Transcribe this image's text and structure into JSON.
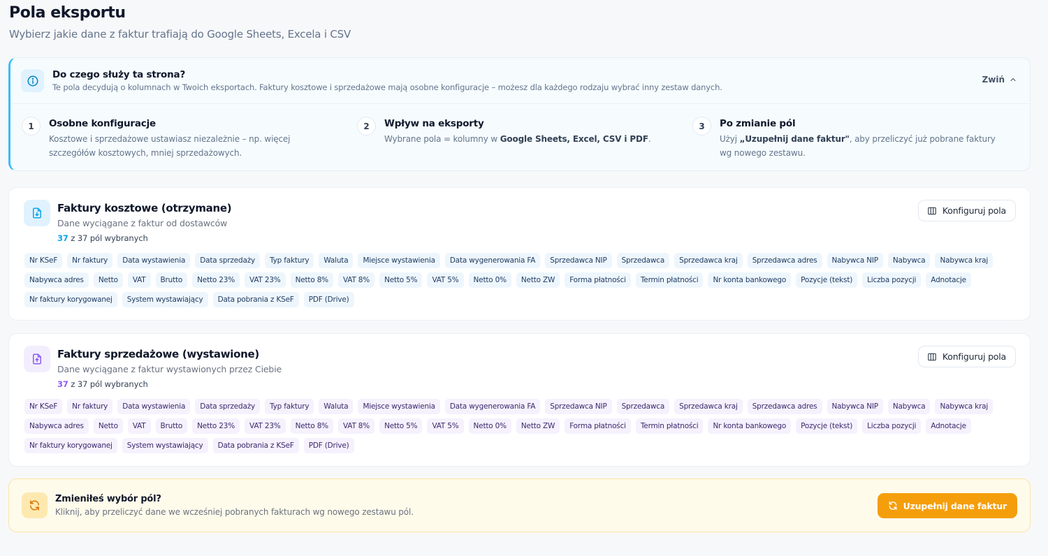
{
  "header": {
    "title": "Pola eksportu",
    "subtitle": "Wybierz jakie dane z faktur trafiają do Google Sheets, Excela i CSV"
  },
  "info": {
    "icon": "info-icon",
    "title": "Do czego służy ta strona?",
    "description": "Te pola decydują o kolumnach w Twoich eksportach. Faktury kosztowe i sprzedażowe mają osobne konfiguracje – możesz dla każdego rodzaju wybrać inny zestaw danych.",
    "collapse_label": "Zwiń",
    "steps": [
      {
        "num": "1",
        "title": "Osobne konfiguracje",
        "pre": "Kosztowe i sprzedażowe ustawiasz niezależnie – np. więcej szczegółów kosztowych, mniej sprzedażowych.",
        "bold": "",
        "post": ""
      },
      {
        "num": "2",
        "title": "Wpływ na eksporty",
        "pre": "Wybrane pola = kolumny w ",
        "bold": "Google Sheets, Excel, CSV i PDF",
        "post": "."
      },
      {
        "num": "3",
        "title": "Po zmianie pól",
        "pre": "Użyj ",
        "bold": "„Uzupełnij dane faktur\"",
        "post": ", aby przeliczyć już pobrane faktury wg nowego zestawu."
      }
    ]
  },
  "cost": {
    "icon": "file-download-icon",
    "title": "Faktury kosztowe (otrzymane)",
    "subtitle": "Dane wyciągane z faktur od dostawców",
    "selected": "37",
    "count_rest": " z 37 pól wybranych",
    "config_label": "Konfiguruj pola",
    "accent": "#0ea5e9",
    "fields": [
      "Nr KSeF",
      "Nr faktury",
      "Data wystawienia",
      "Data sprzedaży",
      "Typ faktury",
      "Waluta",
      "Miejsce wystawienia",
      "Data wygenerowania FA",
      "Sprzedawca NIP",
      "Sprzedawca",
      "Sprzedawca kraj",
      "Sprzedawca adres",
      "Nabywca NIP",
      "Nabywca",
      "Nabywca kraj",
      "Nabywca adres",
      "Netto",
      "VAT",
      "Brutto",
      "Netto 23%",
      "VAT 23%",
      "Netto 8%",
      "VAT 8%",
      "Netto 5%",
      "VAT 5%",
      "Netto 0%",
      "Netto ZW",
      "Forma płatności",
      "Termin płatności",
      "Nr konta bankowego",
      "Pozycje (tekst)",
      "Liczba pozycji",
      "Adnotacje",
      "Nr faktury korygowanej",
      "System wystawiający",
      "Data pobrania z KSeF",
      "PDF (Drive)"
    ]
  },
  "sales": {
    "icon": "file-upload-icon",
    "title": "Faktury sprzedażowe (wystawione)",
    "subtitle": "Dane wyciągane z faktur wystawionych przez Ciebie",
    "selected": "37",
    "count_rest": " z 37 pól wybranych",
    "config_label": "Konfiguruj pola",
    "accent": "#8b5cf6",
    "fields": [
      "Nr KSeF",
      "Nr faktury",
      "Data wystawienia",
      "Data sprzedaży",
      "Typ faktury",
      "Waluta",
      "Miejsce wystawienia",
      "Data wygenerowania FA",
      "Sprzedawca NIP",
      "Sprzedawca",
      "Sprzedawca kraj",
      "Sprzedawca adres",
      "Nabywca NIP",
      "Nabywca",
      "Nabywca kraj",
      "Nabywca adres",
      "Netto",
      "VAT",
      "Brutto",
      "Netto 23%",
      "VAT 23%",
      "Netto 8%",
      "VAT 8%",
      "Netto 5%",
      "VAT 5%",
      "Netto 0%",
      "Netto ZW",
      "Forma płatności",
      "Termin płatności",
      "Nr konta bankowego",
      "Pozycje (tekst)",
      "Liczba pozycji",
      "Adnotacje",
      "Nr faktury korygowanej",
      "System wystawiający",
      "Data pobrania z KSeF",
      "PDF (Drive)"
    ]
  },
  "banner": {
    "icon": "refresh-icon",
    "title": "Zmieniłeś wybór pól?",
    "text": "Kliknij, aby przeliczyć dane we wcześniej pobranych fakturach wg nowego zestawu pól.",
    "button_label": "Uzupełnij dane faktur",
    "accent": "#f59e0b"
  }
}
